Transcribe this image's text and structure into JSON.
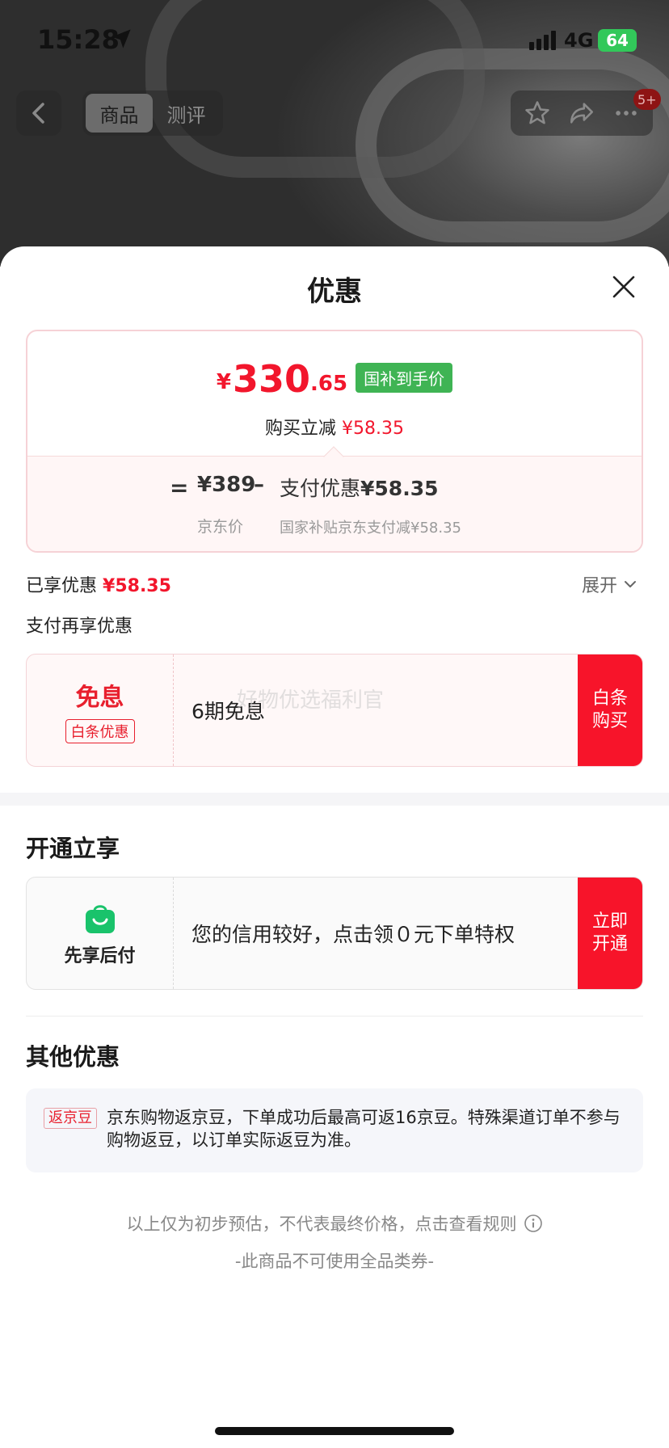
{
  "status_bar": {
    "time": "15:28",
    "network": "4G",
    "battery": "64"
  },
  "nav": {
    "tabs": [
      {
        "label": "商品",
        "active": true
      },
      {
        "label": "测评",
        "active": false
      }
    ],
    "badge": "5+",
    "icons": [
      "back-icon",
      "star-icon",
      "share-icon",
      "more-icon"
    ]
  },
  "sheet": {
    "title": "优惠",
    "price": {
      "yen": "¥",
      "integer": "330",
      "decimal": ".65",
      "tag": "国补到手价",
      "sub_label": "购买立减",
      "sub_value": "¥58.35"
    },
    "calc": {
      "equals": "=",
      "jd_price": "¥389",
      "minus": "–",
      "pay_label": "支付优惠",
      "pay_value": "¥58.35",
      "jd_price_label": "京东价",
      "pay_detail": "国家补贴京东支付减¥58.35"
    },
    "enjoyed": {
      "label": "已享优惠",
      "value": "¥58.35"
    },
    "expand_label": "展开",
    "pay_section_title": "支付再享优惠",
    "baitiao_offer": {
      "big": "免息",
      "tag": "白条优惠",
      "text": "6期免息",
      "watermark": "好物优选福利官",
      "button": "白条购买"
    },
    "open_section_title": "开通立享",
    "xianxiang_offer": {
      "label": "先享后付",
      "text": "您的信用较好，点击领０元下单特权",
      "button": "立即开通"
    },
    "other_section_title": "其他优惠",
    "other": {
      "tag": "返京豆",
      "text": "京东购物返京豆，下单成功后最高可返16京豆。特殊渠道订单不参与购物返豆，以订单实际返豆为准。"
    },
    "footnote": "以上仅为初步预估，不代表最终价格，点击查看规则",
    "footnote2": "-此商品不可使用全品类券-"
  },
  "colors": {
    "accent_red": "#f2162c",
    "green_tag": "#3fb454",
    "bag_green": "#19c36b"
  }
}
